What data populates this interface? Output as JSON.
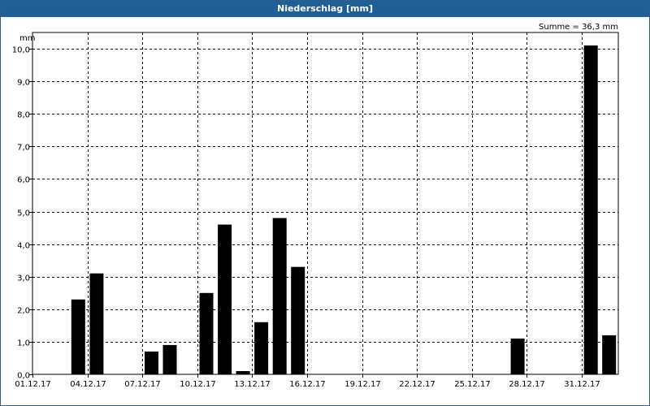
{
  "window": {
    "title": "Niederschlag [mm]"
  },
  "chart_data": {
    "type": "bar",
    "title": "Niederschlag [mm]",
    "unit_label": "mm",
    "sum_label": "Summe = 36,3 mm",
    "ylim": [
      0,
      10.5
    ],
    "y_ticks": [
      "0,0",
      "1,0",
      "2,0",
      "3,0",
      "4,0",
      "5,0",
      "6,0",
      "7,0",
      "8,0",
      "9,0",
      "10,0"
    ],
    "x_ticks": [
      "01.12.17",
      "04.12.17",
      "07.12.17",
      "10.12.17",
      "13.12.17",
      "16.12.17",
      "19.12.17",
      "22.12.17",
      "25.12.17",
      "28.12.17",
      "31.12.17"
    ],
    "grid": true,
    "bar_color": "#000000",
    "grid_color": "#000000",
    "categories": [
      "01.12.17",
      "02.12.17",
      "03.12.17",
      "04.12.17",
      "05.12.17",
      "06.12.17",
      "07.12.17",
      "08.12.17",
      "09.12.17",
      "10.12.17",
      "11.12.17",
      "12.12.17",
      "13.12.17",
      "14.12.17",
      "15.12.17",
      "16.12.17",
      "17.12.17",
      "18.12.17",
      "19.12.17",
      "20.12.17",
      "21.12.17",
      "22.12.17",
      "23.12.17",
      "24.12.17",
      "25.12.17",
      "26.12.17",
      "27.12.17",
      "28.12.17",
      "29.12.17",
      "30.12.17",
      "31.12.17",
      "01.01.18"
    ],
    "values": [
      0,
      0,
      2.3,
      3.1,
      0,
      0,
      0.7,
      0.9,
      0,
      2.5,
      4.6,
      0.1,
      1.6,
      4.8,
      3.3,
      0,
      0,
      0,
      0,
      0,
      0,
      0,
      0,
      0,
      0,
      0,
      1.1,
      0,
      0,
      0,
      10.1,
      1.2
    ]
  }
}
